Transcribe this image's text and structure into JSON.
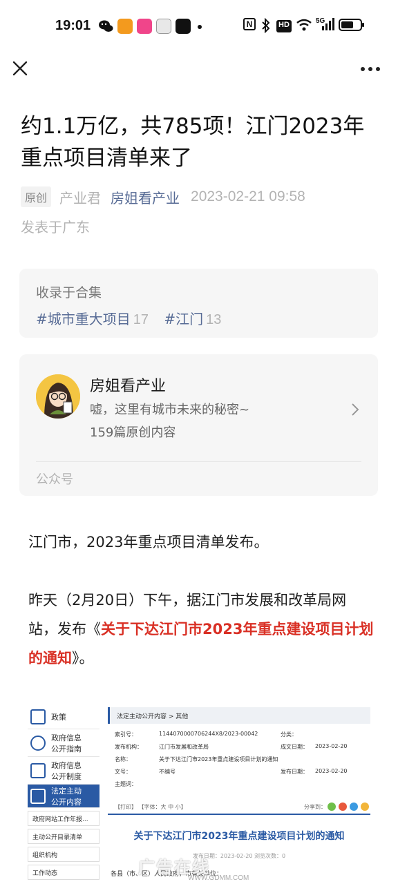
{
  "status_bar": {
    "time": "19:01",
    "network": "5G",
    "hd": "HD",
    "nfc": "N"
  },
  "nav": {
    "close_icon": "close-icon",
    "more_icon": "more-icon"
  },
  "article": {
    "title": "约1.1万亿，共785项！江门2023年重点项目清单来了",
    "badge": "原创",
    "author": "产业君",
    "account": "房姐看产业",
    "date": "2023-02-21 09:58",
    "location": "发表于广东"
  },
  "collection": {
    "title": "收录于合集",
    "tags": [
      {
        "label": "#城市重大项目",
        "count": "17"
      },
      {
        "label": "#江门",
        "count": "13"
      }
    ]
  },
  "profile": {
    "name": "房姐看产业",
    "description": "嘘，这里有城市未来的秘密~",
    "count": "159篇原创内容",
    "type": "公众号"
  },
  "body": {
    "para1": "江门市，2023年重点项目清单发布。",
    "para2_prefix": "昨天（2月20日）下午，据江门市发展和改革局网站，发布《",
    "para2_link": "关于下达江门市2023年重点建设项目计划的通知",
    "para2_suffix": "》。"
  },
  "embed": {
    "sidebar": [
      "政策",
      "政府信息公开指南",
      "政府信息公开制度",
      "法定主动公开内容"
    ],
    "sub_items": [
      "政府网站工作年报...",
      "主动公开目录清单",
      "组织机构",
      "工作动态"
    ],
    "breadcrumb": "法定主动公开内容 > 其他",
    "rows": [
      {
        "l1": "索引号：",
        "v1": "11440700007062​44X8/2023-00042",
        "l2": "分类：",
        "v2": ""
      },
      {
        "l1": "发布机构：",
        "v1": "江门市发展和改革局",
        "l2": "成文日期：",
        "v2": "2023-02-20"
      },
      {
        "l1": "名称：",
        "v1": "关于下达江门市2023年重点建设项目计划的通知",
        "l2": "",
        "v2": ""
      },
      {
        "l1": "文号：",
        "v1": "不编号",
        "l2": "发布日期：",
        "v2": "2023-02-20"
      },
      {
        "l1": "主题词：",
        "v1": "",
        "l2": "",
        "v2": ""
      }
    ],
    "tools": "【打印】 【字体：大 中 小】",
    "share": "分享到：",
    "doc_title": "关于下达江门市2023年重点建设项目计划的通知",
    "doc_meta": "发布日期：2023-02-20  浏览次数：0",
    "doc_text": "各县（市、区）人民政府，市有关单位：",
    "watermark": "广告在线",
    "watermark_url": "WWW.GDMM.COM"
  }
}
